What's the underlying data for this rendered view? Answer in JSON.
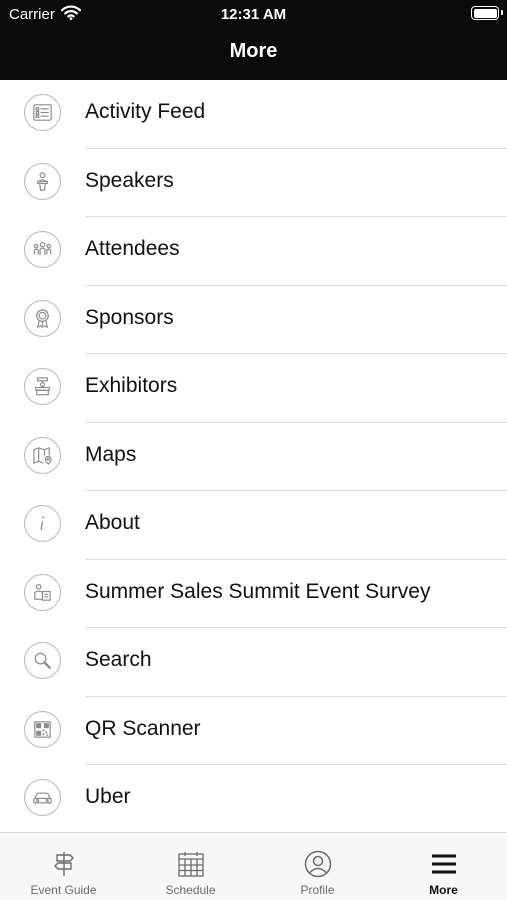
{
  "status_bar": {
    "carrier": "Carrier",
    "time": "12:31 AM"
  },
  "nav": {
    "title": "More"
  },
  "menu": {
    "items": [
      {
        "label": "Activity Feed",
        "icon": "activity-feed-icon"
      },
      {
        "label": "Speakers",
        "icon": "speaker-podium-icon"
      },
      {
        "label": "Attendees",
        "icon": "attendees-group-icon"
      },
      {
        "label": "Sponsors",
        "icon": "award-ribbon-icon"
      },
      {
        "label": "Exhibitors",
        "icon": "exhibitor-booth-icon"
      },
      {
        "label": "Maps",
        "icon": "map-pin-icon"
      },
      {
        "label": "About",
        "icon": "info-icon"
      },
      {
        "label": "Summer Sales Summit Event Survey",
        "icon": "survey-icon"
      },
      {
        "label": "Search",
        "icon": "search-icon"
      },
      {
        "label": "QR Scanner",
        "icon": "qr-code-icon"
      },
      {
        "label": "Uber",
        "icon": "car-icon"
      }
    ]
  },
  "tab_bar": {
    "tabs": [
      {
        "label": "Event Guide",
        "icon": "signpost-icon"
      },
      {
        "label": "Schedule",
        "icon": "calendar-icon"
      },
      {
        "label": "Profile",
        "icon": "profile-icon"
      },
      {
        "label": "More",
        "icon": "hamburger-menu-icon",
        "active": true
      }
    ]
  },
  "colors": {
    "header_bg": "#0b0b0b",
    "icon_stroke": "#8a8a8a",
    "divider": "#dedede"
  }
}
